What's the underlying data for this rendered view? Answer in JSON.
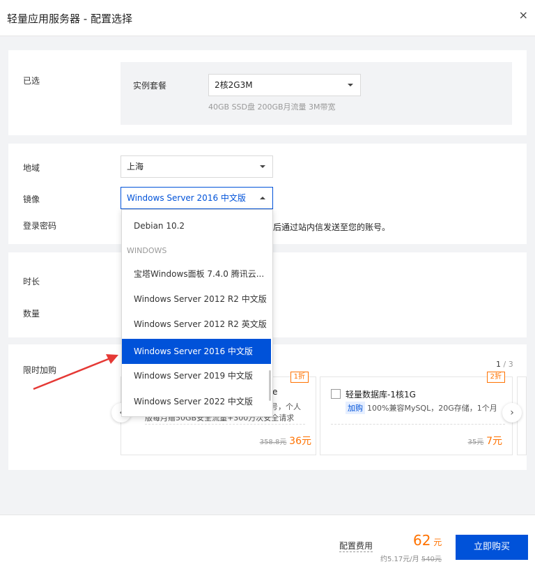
{
  "header": {
    "title": "轻量应用服务器 - 配置选择",
    "close": "×"
  },
  "selected": {
    "label": "已选",
    "package_label": "实例套餐",
    "package_value": "2核2G3M",
    "package_hint": "40GB SSD盘 200GB月流量 3M带宽"
  },
  "config": {
    "region_label": "地域",
    "region_value": "上海",
    "image_label": "镜像",
    "image_value": "Windows Server 2016 中文版",
    "password_label": "登录密码",
    "password_hint": "后通过站内信发送至您的账号。"
  },
  "duration": {
    "duration_label": "时长",
    "quantity_label": "数量"
  },
  "dropdown": {
    "items_top": [
      "Debian 10.2"
    ],
    "group": "WINDOWS",
    "items": [
      "宝塔Windows面板 7.4.0 腾讯云...",
      "Windows Server 2012 R2 中文版",
      "Windows Server 2012 R2 英文版",
      "Windows Server 2016 中文版",
      "Windows Server 2019 中文版",
      "Windows Server 2022 中文版"
    ],
    "selected_index": 3
  },
  "flash": {
    "label": "限时加购",
    "pager": "1",
    "pager_total": "/ 3",
    "card1": {
      "discount": "1折",
      "title_suffix": "e",
      "desc_line1": "号，个人",
      "desc_line2": "版每月赠50GB安全流量+300万次安全请求",
      "old_price": "358.8元",
      "new_price": "36元"
    },
    "card2": {
      "discount": "2折",
      "title": "轻量数据库-1核1G",
      "tag": "加购",
      "desc": "100%兼容MySQL，20G存储，1个月",
      "old_price": "35元",
      "new_price": "7元"
    },
    "prev": "‹",
    "next": "›"
  },
  "footer": {
    "fee_label": "配置费用",
    "price": "62",
    "unit": "元",
    "monthly": "约5.17元/月",
    "old_price": "540元",
    "buy": "立即购买"
  },
  "colors": {
    "accent": "#0052d9",
    "orange": "#ff7200",
    "annotation_arrow": "#e53935"
  }
}
